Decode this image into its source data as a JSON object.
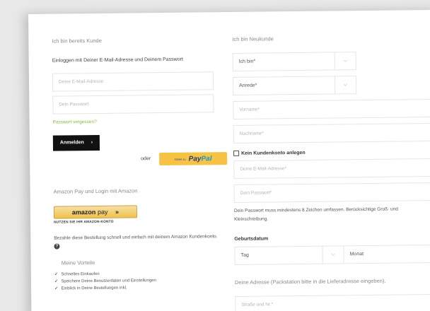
{
  "left": {
    "section_title": "Ich bin bereits Kunde",
    "login_heading": "Einloggen mit Deiner E-Mail-Adresse und Deinem Passwort",
    "email_placeholder": "Deine E-Mail-Adresse",
    "password_placeholder": "Dein Passwort",
    "forgot_link": "Passwort vergessen?",
    "login_button": "Anmelden",
    "or_text": "oder",
    "paypal_small": "Direkt zu",
    "paypal_brand_a": "Pay",
    "paypal_brand_b": "Pal",
    "amazon_title": "Amazon Pay und Login mit Amazon",
    "amazon_button_a": "amazon",
    "amazon_button_b": "pay",
    "amazon_button_arrows": "»",
    "amazon_sub": "NUTZEN SIE IHR AMAZON-KONTO",
    "amazon_text": "Bezahle diese Bestellung schnell und einfach mit deinem Amazon Kundenkonto.",
    "advantages_title": "Meine Vorteile",
    "advantages": [
      "Schnelles Einkaufen",
      "Speichere Deine Benutzerdaten und Einstellungen",
      "Einblick in Deine Bestellungen inkl."
    ]
  },
  "right": {
    "section_title": "Ich bin Neukunde",
    "salutation_select": "Ich bin*",
    "title_select": "Anrede*",
    "firstname_placeholder": "Vorname*",
    "lastname_placeholder": "Nachname*",
    "no_account_label": "Kein Kundenkonto anlegen",
    "email_placeholder": "Deine E-Mail-Adresse*",
    "password_placeholder": "Dein Passwort*",
    "password_hint": "Dein Passwort muss mindestens 8 Zeichen umfassen. Berücksichtige Groß- und Kleinschreibung.",
    "birthdate_label": "Geburtsdatum",
    "day_select": "Tag",
    "month_select": "Monat",
    "address_hint": "Deine Adresse (Packstation bitte in die Lieferadresse eingeben).",
    "street_placeholder": "Straße und Nr.*"
  },
  "icons": {
    "chevron": "⌵",
    "arrow": "›",
    "check": "✓",
    "help": "?"
  }
}
